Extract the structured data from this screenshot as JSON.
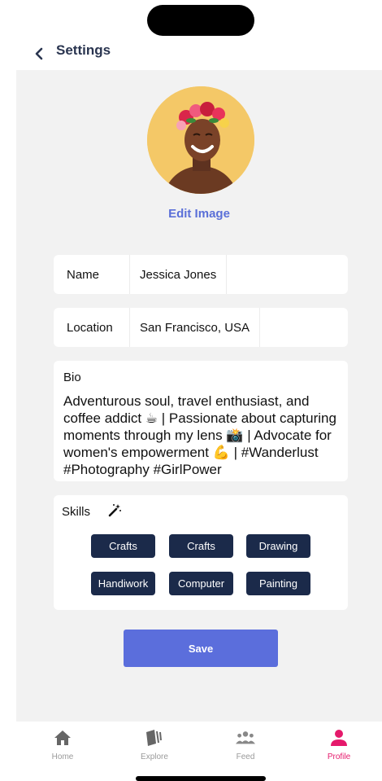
{
  "header": {
    "title": "Settings"
  },
  "profile": {
    "edit_image_label": "Edit Image"
  },
  "fields": {
    "name": {
      "label": "Name",
      "value": "Jessica Jones"
    },
    "location": {
      "label": "Location",
      "value": "San Francisco, USA"
    }
  },
  "bio": {
    "label": "Bio",
    "text": "Adventurous soul, travel enthusiast, and coffee addict ☕ | Passionate about capturing moments through my lens 📸 | Advocate for women's empowerment 💪 | #Wanderlust #Photography #GirlPower"
  },
  "skills": {
    "label": "Skills",
    "items": [
      "Crafts",
      "Crafts",
      "Drawing",
      "Handiwork",
      "Computer",
      "Painting"
    ]
  },
  "save_label": "Save",
  "tabs": [
    {
      "label": "Home",
      "icon": "home-icon"
    },
    {
      "label": "Explore",
      "icon": "explore-icon"
    },
    {
      "label": "Feed",
      "icon": "feed-icon"
    },
    {
      "label": "Profile",
      "icon": "profile-icon",
      "active": true
    }
  ],
  "colors": {
    "accent": "#5b6edc",
    "skill_bg": "#1b2a4a",
    "active_tab": "#e5196b",
    "title": "#2a3550"
  }
}
